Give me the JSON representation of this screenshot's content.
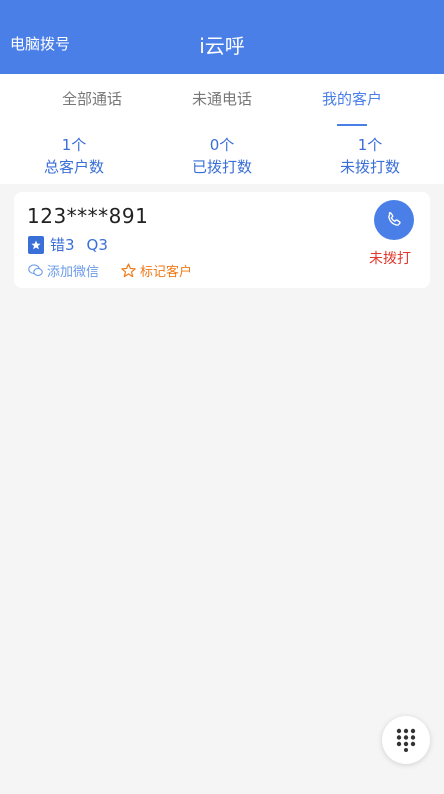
{
  "header": {
    "left_label": "电脑拨号",
    "title": "i云呼"
  },
  "tabs": [
    {
      "label": "全部通话",
      "active": false
    },
    {
      "label": "未通电话",
      "active": false
    },
    {
      "label": "我的客户",
      "active": true
    }
  ],
  "stats": [
    {
      "count": "1个",
      "label": "总客户数"
    },
    {
      "count": "0个",
      "label": "已拨打数"
    },
    {
      "count": "1个",
      "label": "未拨打数"
    }
  ],
  "customers": [
    {
      "phone": "123****891",
      "tag": "错3",
      "quality": "Q3",
      "wechat_label": "添加微信",
      "mark_label": "标记客户",
      "status": "未拨打"
    }
  ],
  "icons": {
    "call": "phone-icon",
    "dialpad": "dialpad-icon",
    "wechat": "wechat-icon",
    "mark": "star-icon",
    "tag": "bookmark-icon"
  },
  "colors": {
    "primary": "#4a7fe8",
    "status_red": "#e23a2e",
    "mark_orange": "#f07a18"
  }
}
